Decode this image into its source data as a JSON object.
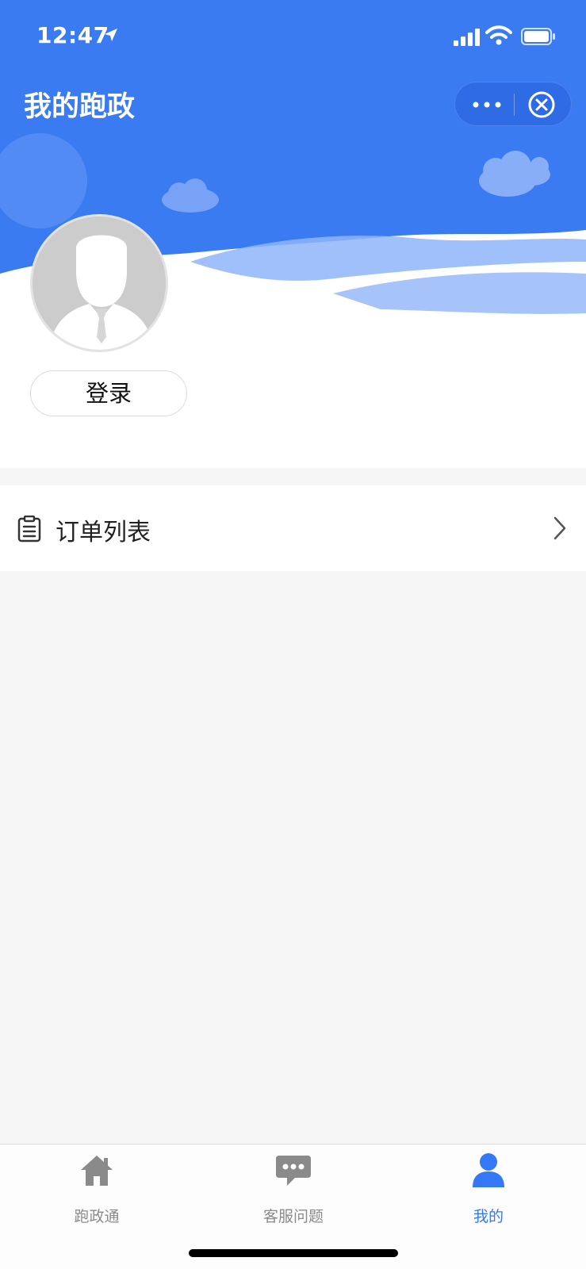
{
  "status_bar": {
    "time": "12:47"
  },
  "header": {
    "title": "我的跑政"
  },
  "profile": {
    "login_label": "登录"
  },
  "menu": {
    "items": [
      {
        "label": "订单列表",
        "icon": "clipboard-icon"
      }
    ]
  },
  "tabbar": {
    "tabs": [
      {
        "label": "跑政通",
        "icon": "home-icon",
        "active": false
      },
      {
        "label": "客服问题",
        "icon": "chat-bubble-icon",
        "active": false
      },
      {
        "label": "我的",
        "icon": "user-icon",
        "active": true
      }
    ]
  },
  "colors": {
    "brand_blue": "#3478f6",
    "tab_inactive": "#8a8a8a",
    "background": "#f6f6f6"
  }
}
